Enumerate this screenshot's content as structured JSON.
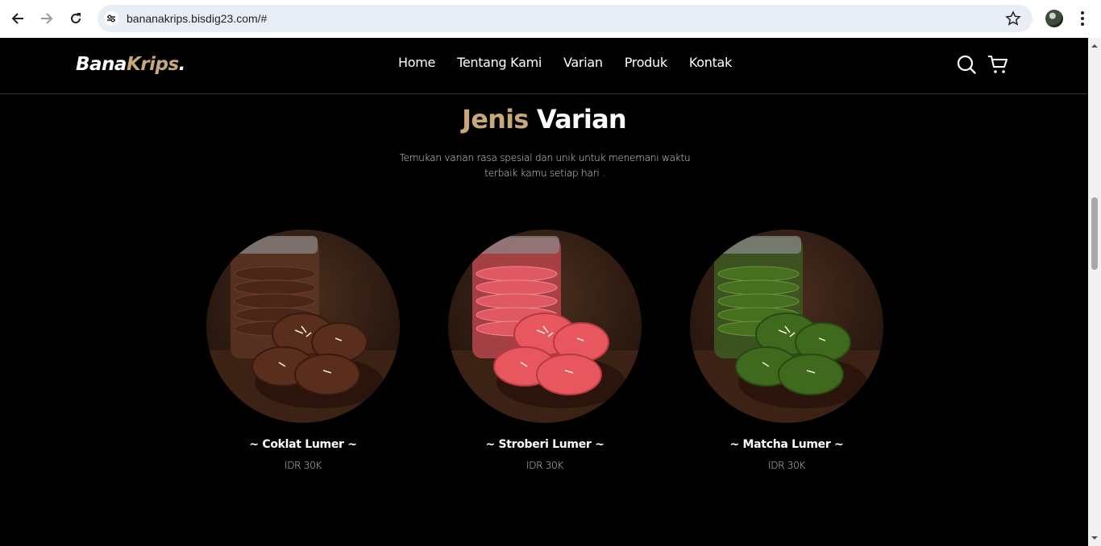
{
  "browser": {
    "url": "bananakrips.bisdig23.com/#",
    "icons": {
      "back": "arrow-left-icon",
      "forward": "arrow-right-icon",
      "reload": "reload-icon",
      "site_info": "tune-icon",
      "bookmark": "star-icon",
      "menu": "kebab-menu-icon"
    }
  },
  "header": {
    "logo": {
      "part1": "Bana",
      "part2": "Krips",
      "dot": "."
    },
    "nav": [
      "Home",
      "Tentang Kami",
      "Varian",
      "Produk",
      "Kontak"
    ],
    "icons": {
      "search": "search-icon",
      "cart": "shopping-cart-icon"
    }
  },
  "section": {
    "title_accent": "Jenis",
    "title_rest": "Varian",
    "description": "Temukan varian rasa spesial dan unik untuk menemani waktu terbaik kamu setiap hari ."
  },
  "variants": [
    {
      "name": "~ Coklat Lumer ~",
      "price": "IDR 30K",
      "color": "#5a2e1c"
    },
    {
      "name": "~ Stroberi Lumer ~",
      "price": "IDR 30K",
      "color": "#e8565e"
    },
    {
      "name": "~ Matcha Lumer ~",
      "price": "IDR 30K",
      "color": "#3f6a1e"
    }
  ],
  "colors": {
    "accent": "#c7a77b",
    "background": "#000000",
    "urlbar": "#e9eef6"
  }
}
